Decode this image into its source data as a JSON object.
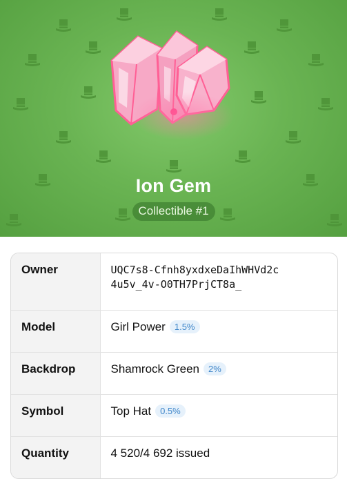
{
  "gift": {
    "title": "Ion Gem",
    "subtitle": "Collectible #1"
  },
  "icons": {
    "artwork": "pink-crystal-gem-icon",
    "pattern": "top-hat-icon",
    "background_color": "#6ab453",
    "gem_color": "#ff8fb8"
  },
  "details": {
    "owner": {
      "label": "Owner",
      "line1": "UQC7s8-Cfnh8yxdxeDaIhWHVd2c",
      "line2": "4u5v_4v-O0TH7PrjCT8a_"
    },
    "model": {
      "label": "Model",
      "value": "Girl Power",
      "rarity": "1.5%"
    },
    "backdrop": {
      "label": "Backdrop",
      "value": "Shamrock Green",
      "rarity": "2%"
    },
    "symbol": {
      "label": "Symbol",
      "value": "Top Hat",
      "rarity": "0.5%"
    },
    "quantity": {
      "label": "Quantity",
      "value": "4 520/4 692 issued"
    }
  }
}
